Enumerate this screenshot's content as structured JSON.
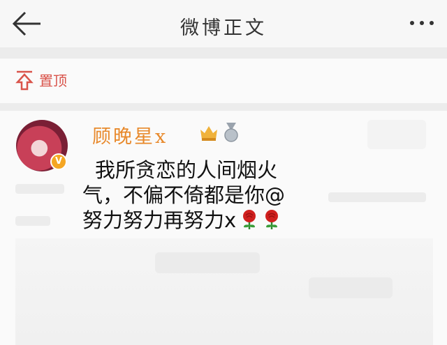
{
  "header": {
    "title": "微博正文"
  },
  "pin": {
    "label": "置顶"
  },
  "post": {
    "username": "顾晚星x",
    "text_lines": [
      "我所贪恋的人间烟火",
      "气，不偏不倚都是你@",
      "努力努力再努力x"
    ]
  },
  "colors": {
    "username": "#e8892b",
    "pin": "#d9534a",
    "rose": "#d0201e"
  },
  "icons": [
    "back-arrow-icon",
    "more-icon",
    "pin-icon",
    "crown-badge-icon",
    "medal-icon",
    "verified-badge-icon",
    "rose-emoji"
  ]
}
